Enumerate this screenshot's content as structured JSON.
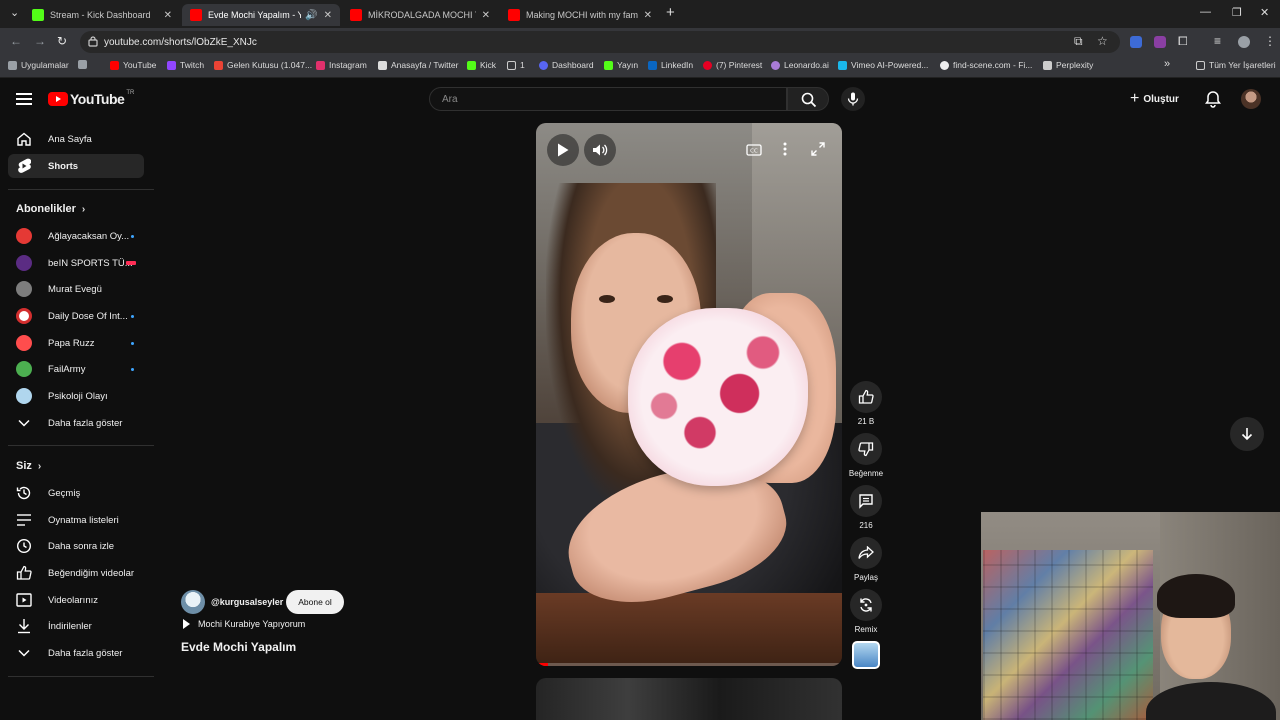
{
  "browser": {
    "tabs": [
      {
        "label": "Stream - Kick Dashboard",
        "favicon_color": "#53fc18",
        "active": false
      },
      {
        "label": "Evde Mochi Yapalım - YouTube",
        "favicon_color": "#ff0000",
        "active": true
      },
      {
        "label": "MİKRODALGADA MOCHI YAPMA",
        "favicon_color": "#ff0000",
        "active": false
      },
      {
        "label": "Making MOCHI with my family",
        "favicon_color": "#ff0000",
        "active": false
      }
    ],
    "url": "youtube.com/shorts/lObZkE_XNJc",
    "bookmarks": [
      {
        "label": "Uygulamalar",
        "color": "#c4c4c4"
      },
      {
        "label": "",
        "color": "#c4c4c4"
      },
      {
        "label": "YouTube",
        "color": "#ff0000"
      },
      {
        "label": "Twitch",
        "color": "#9146ff"
      },
      {
        "label": "Gelen Kutusu (1.047...",
        "color": "#ea4335"
      },
      {
        "label": "Instagram",
        "color": "#e1306c"
      },
      {
        "label": "Anasayfa / Twitter",
        "color": "#dddddd"
      },
      {
        "label": "Kick",
        "color": "#53fc18"
      },
      {
        "label": "1",
        "color": "#c4c4c4"
      },
      {
        "label": "Dashboard",
        "color": "#5865f2"
      },
      {
        "label": "Yayın",
        "color": "#53fc18"
      },
      {
        "label": "LinkedIn",
        "color": "#0a66c2"
      },
      {
        "label": "(7) Pinterest",
        "color": "#e60023"
      },
      {
        "label": "Leonardo.ai",
        "color": "#a97bd6"
      },
      {
        "label": "Vimeo AI-Powered...",
        "color": "#1ab7ea"
      },
      {
        "label": "find-scene.com - Fi...",
        "color": "#eeeeee"
      },
      {
        "label": "Perplexity",
        "color": "#cccccc"
      }
    ],
    "bookmarks_more": "»",
    "all_bookmarks": "Tüm Yer İşaretleri"
  },
  "youtube": {
    "logo_text": "YouTube",
    "country": "TR",
    "search_placeholder": "Ara",
    "create_label": "Oluştur",
    "sidebar": {
      "main": [
        {
          "label": "Ana Sayfa",
          "icon": "home-icon"
        },
        {
          "label": "Shorts",
          "icon": "shorts-icon",
          "active": true
        }
      ],
      "subscriptions_title": "Abonelikler",
      "subscriptions": [
        {
          "label": "Ağlayacaksan Oy...",
          "color": "#e53935",
          "indicator": "dot"
        },
        {
          "label": "beIN SPORTS TÜ...",
          "color": "#5b2c83",
          "indicator": "live"
        },
        {
          "label": "Murat Evegü",
          "color": "#7d7d7d",
          "indicator": "none"
        },
        {
          "label": "Daily Dose Of Int...",
          "color": "#d32f2f",
          "indicator": "dot"
        },
        {
          "label": "Papa Ruzz",
          "color": "#ff4d4d",
          "indicator": "dot"
        },
        {
          "label": "FailArmy",
          "color": "#4caf50",
          "indicator": "dot"
        },
        {
          "label": "Psikoloji Olayı",
          "color": "#b0d6ee",
          "indicator": "none"
        }
      ],
      "show_more": "Daha fazla göster",
      "you_title": "Siz",
      "you_items": [
        {
          "label": "Geçmiş",
          "icon": "history-icon"
        },
        {
          "label": "Oynatma listeleri",
          "icon": "playlist-icon"
        },
        {
          "label": "Daha sonra izle",
          "icon": "clock-icon"
        },
        {
          "label": "Beğendiğim videolar",
          "icon": "like-icon"
        },
        {
          "label": "Videolarınız",
          "icon": "video-icon"
        },
        {
          "label": "İndirilenler",
          "icon": "download-icon"
        }
      ],
      "show_more_2": "Daha fazla göster"
    },
    "short": {
      "channel": "@kurgusalseyler",
      "subscribe_label": "Abone ol",
      "music": "Mochi Kurabiye Yapıyorum",
      "title": "Evde Mochi Yapalım",
      "progress": 0.04
    },
    "actions": {
      "likes": "21 B",
      "dislike_label": "Beğenme",
      "comments": "216",
      "share_label": "Paylaş",
      "remix_label": "Remix"
    }
  }
}
